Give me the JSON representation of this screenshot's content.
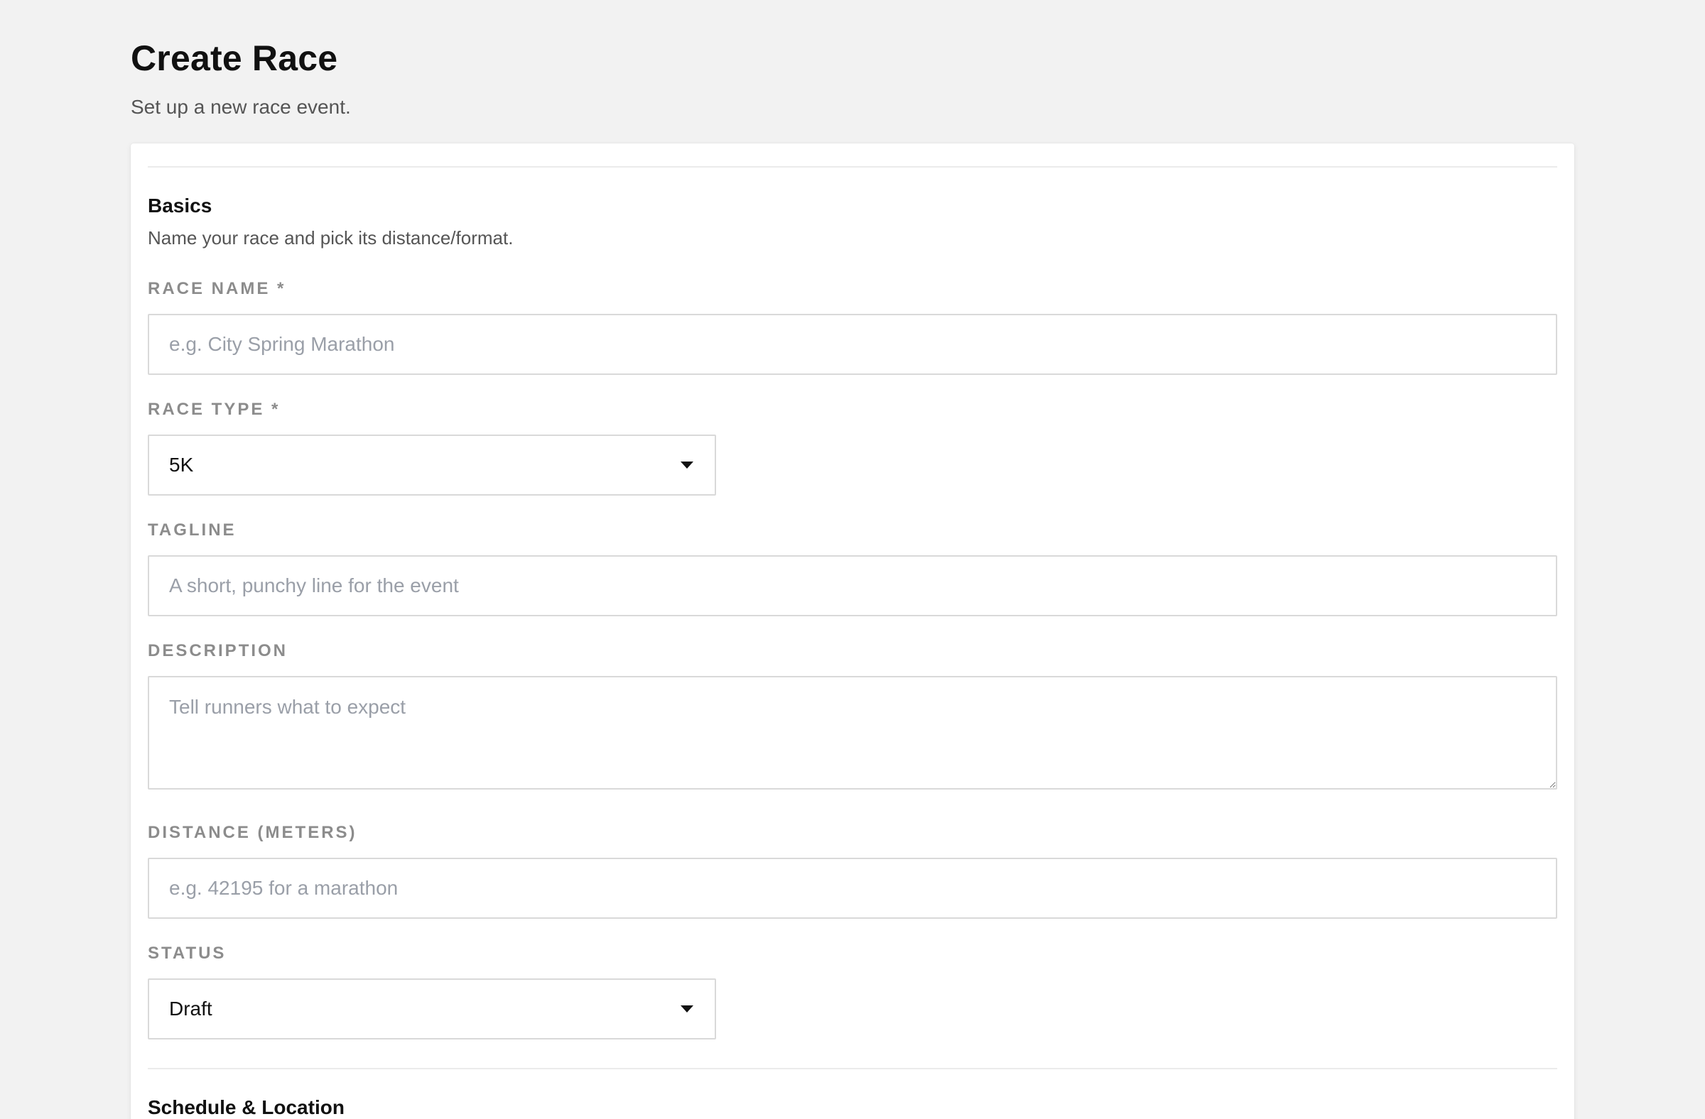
{
  "header": {
    "title": "Create Race",
    "subtitle": "Set up a new race event."
  },
  "basics": {
    "title": "Basics",
    "description": "Name your race and pick its distance/format.",
    "race_name": {
      "label": "RACE NAME *",
      "value": "",
      "placeholder": "e.g. City Spring Marathon"
    },
    "race_type": {
      "label": "RACE TYPE *",
      "selected": "5K",
      "icon": "chevron-down-icon"
    },
    "tagline": {
      "label": "TAGLINE",
      "value": "",
      "placeholder": "A short, punchy line for the event"
    },
    "description_field": {
      "label": "DESCRIPTION",
      "value": "",
      "placeholder": "Tell runners what to expect"
    },
    "distance": {
      "label": "DISTANCE (METERS)",
      "value": "",
      "placeholder": "e.g. 42195 for a marathon"
    },
    "status": {
      "label": "STATUS",
      "selected": "Draft",
      "icon": "chevron-down-icon"
    }
  },
  "schedule": {
    "title": "Schedule & Location"
  }
}
